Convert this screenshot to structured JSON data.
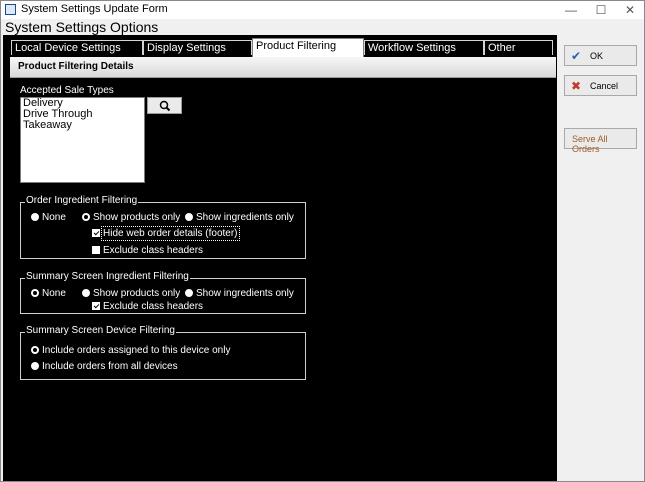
{
  "window": {
    "title": "System Settings Update Form",
    "header": "System Settings Options",
    "icons": {
      "app": "app-icon",
      "minimize": "minimize-icon",
      "maximize": "maximize-icon",
      "close": "close-icon"
    }
  },
  "tabs": [
    {
      "label": "Local Device Settings"
    },
    {
      "label": "Display Settings"
    },
    {
      "label": "Product Filtering"
    },
    {
      "label": "Workflow Settings"
    },
    {
      "label": "Other"
    }
  ],
  "active_tab": "Product Filtering",
  "panel": {
    "title": "Product Filtering Details",
    "sale_types": {
      "label": "Accepted Sale Types",
      "items": [
        "Delivery",
        "Drive Through",
        "Takeaway"
      ],
      "search_icon": "magnifier-icon"
    },
    "order_ingredient": {
      "title": "Order Ingredient Filtering",
      "options": [
        "None",
        "Show products only",
        "Show ingredients only"
      ],
      "selected": "Show products only",
      "hide_web_order": {
        "label": "Hide web order details (footer)",
        "checked": true
      },
      "exclude_class_headers": {
        "label": "Exclude class headers",
        "checked": false
      }
    },
    "summary_ingredient": {
      "title": "Summary Screen Ingredient Filtering",
      "options": [
        "None",
        "Show products only",
        "Show ingredients only"
      ],
      "selected": "None",
      "exclude_class_headers": {
        "label": "Exclude class headers",
        "checked": true
      }
    },
    "summary_device": {
      "title": "Summary Screen Device Filtering",
      "options": [
        "Include orders assigned to this device only",
        "Include orders from all devices"
      ],
      "selected": "Include orders assigned to this device only"
    }
  },
  "buttons": {
    "ok": "OK",
    "cancel": "Cancel",
    "serve_all": "Serve All Orders"
  },
  "colors": {
    "ok_check": "#2a5fb0",
    "cancel_x": "#c0392b",
    "serve_all_text": "#a05a2c"
  }
}
